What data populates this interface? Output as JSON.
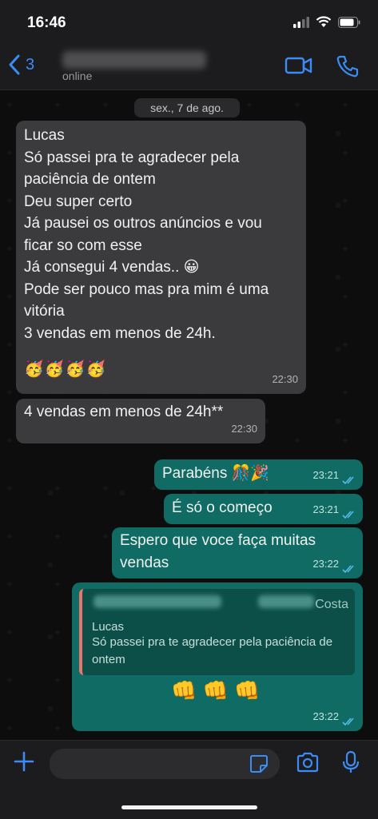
{
  "status_bar": {
    "time": "16:46"
  },
  "header": {
    "back_count": "3",
    "contact_status": "online"
  },
  "chat": {
    "date_chip": "sex., 7 de ago.",
    "msg1": {
      "lines": [
        "Lucas",
        "Só passei pra te agradecer pela",
        "paciência de ontem",
        "Deu super certo",
        "Já pausei os outros anúncios e vou",
        "ficar so com esse",
        "Já consegui 4 vendas.. 😀",
        "Pode ser pouco mas pra mim é uma",
        "vitória",
        "3 vendas em menos de 24h."
      ],
      "emojis": "🥳🥳🥳🥳",
      "time": "22:30"
    },
    "msg2": {
      "text": "4 vendas em menos de 24h**",
      "time": "22:30"
    },
    "msg3": {
      "text": "Parabéns 🎊🎉",
      "time": "23:21"
    },
    "msg4": {
      "text": "É só o começo",
      "time": "23:21"
    },
    "msg5": {
      "lines": [
        "Espero que voce faça muitas",
        "vendas"
      ],
      "time": "23:22"
    },
    "msg6": {
      "quote_name_suffix": "Costa",
      "quote_author": "Lucas",
      "quote_text": "Só passei pra te agradecer pela paciência de ontem",
      "emojis": "👊 👊 👊",
      "time": "23:22"
    }
  },
  "colors": {
    "accent": "#3b8cf6",
    "incoming": "#3b3b3d",
    "outgoing": "#0f6b63",
    "read_ticks": "#53bdeb"
  }
}
